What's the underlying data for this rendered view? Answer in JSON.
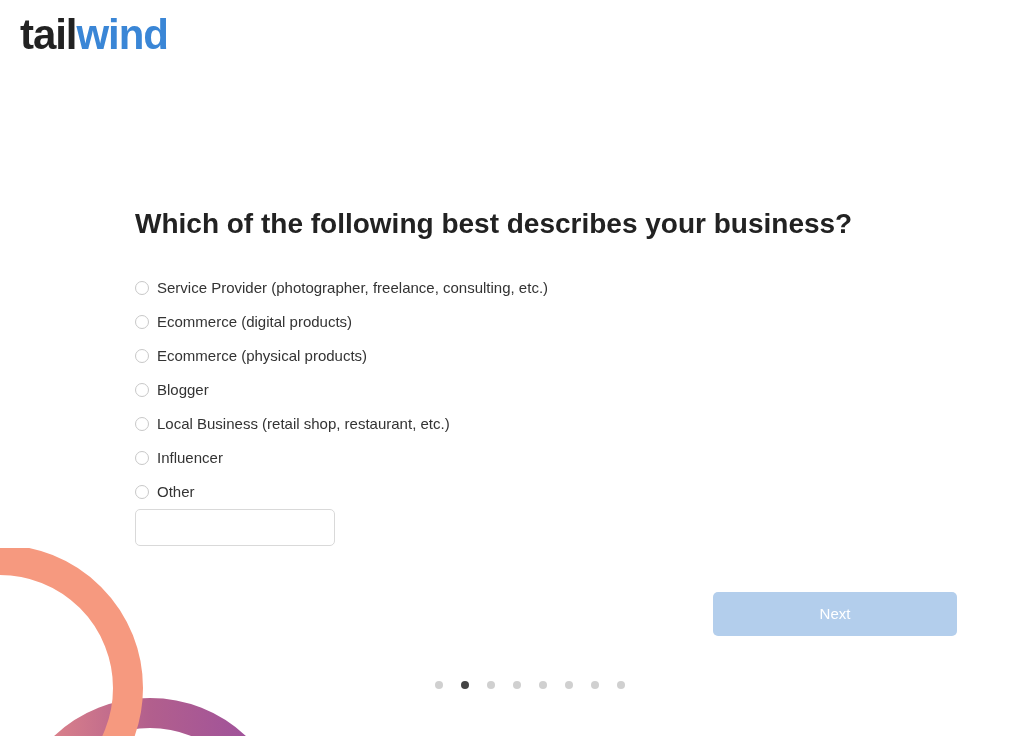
{
  "logo": {
    "first": "tail",
    "second": "wind"
  },
  "question": "Which of the following best describes your business?",
  "options": [
    {
      "label": "Service Provider (photographer, freelance, consulting, etc.)",
      "selected": false
    },
    {
      "label": "Ecommerce (digital products)",
      "selected": false
    },
    {
      "label": "Ecommerce (physical products)",
      "selected": false
    },
    {
      "label": "Blogger",
      "selected": false
    },
    {
      "label": "Local Business (retail shop, restaurant, etc.)",
      "selected": false
    },
    {
      "label": "Influencer",
      "selected": false
    },
    {
      "label": "Other",
      "selected": false
    }
  ],
  "next_button": {
    "label": "Next",
    "disabled": true
  },
  "steps": [
    {
      "selected": false
    },
    {
      "selected": true
    },
    {
      "selected": false
    },
    {
      "selected": false
    },
    {
      "selected": false
    },
    {
      "selected": false
    },
    {
      "selected": false
    },
    {
      "selected": false
    }
  ]
}
